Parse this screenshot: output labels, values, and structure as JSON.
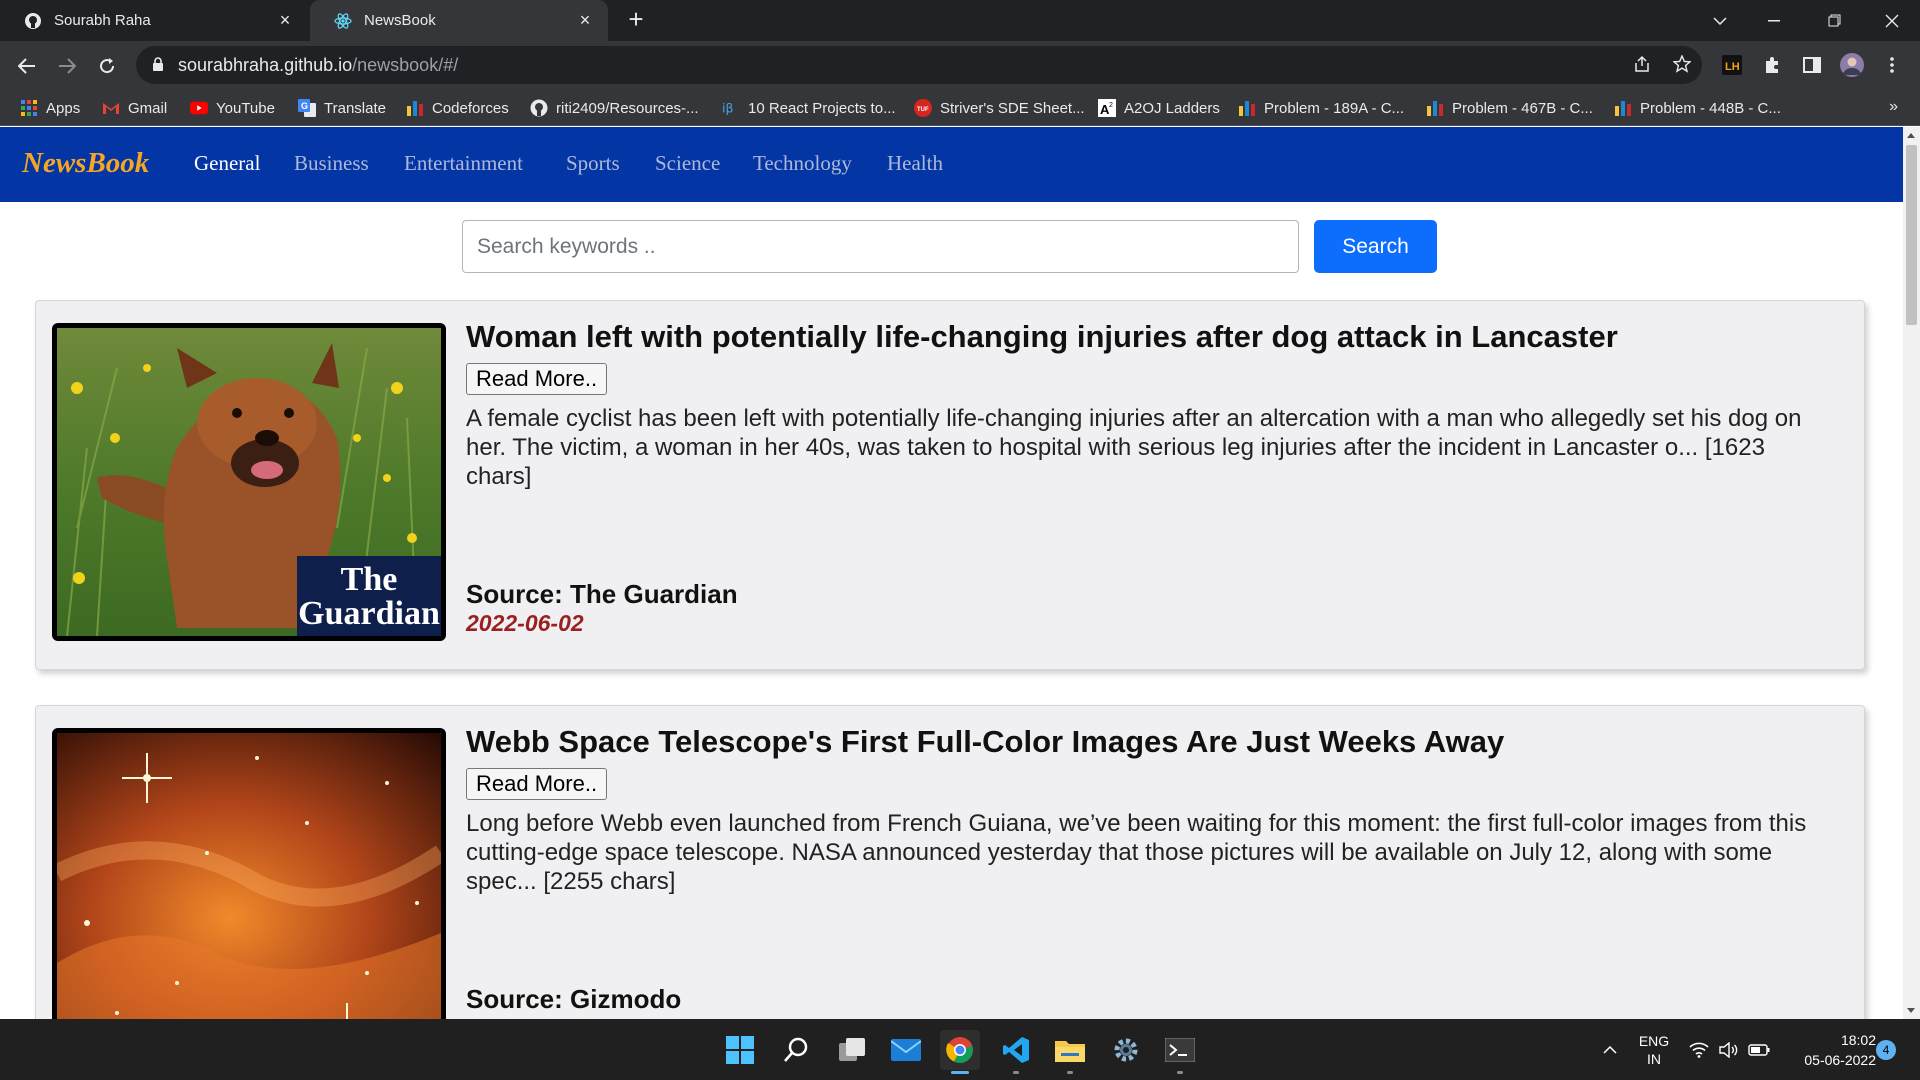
{
  "browser": {
    "tabs": [
      {
        "title": "Sourabh Raha"
      },
      {
        "title": "NewsBook"
      }
    ],
    "url_host": "sourabhraha.github.io",
    "url_path": "/newsbook/#/",
    "bookmarks": [
      {
        "label": "Apps"
      },
      {
        "label": "Gmail"
      },
      {
        "label": "YouTube"
      },
      {
        "label": "Translate"
      },
      {
        "label": "Codeforces"
      },
      {
        "label": "riti2409/Resources-..."
      },
      {
        "label": "10 React Projects to..."
      },
      {
        "label": "Striver's SDE Sheet..."
      },
      {
        "label": "A2OJ Ladders"
      },
      {
        "label": "Problem - 189A - C..."
      },
      {
        "label": "Problem - 467B - C..."
      },
      {
        "label": "Problem - 448B - C..."
      }
    ],
    "bookmarks_more": "»"
  },
  "app": {
    "brand": "NewsBook",
    "nav": [
      {
        "label": "General",
        "active": true
      },
      {
        "label": "Business"
      },
      {
        "label": "Entertainment"
      },
      {
        "label": "Sports"
      },
      {
        "label": "Science"
      },
      {
        "label": "Technology"
      },
      {
        "label": "Health"
      }
    ],
    "search": {
      "placeholder": "Search keywords ..",
      "value": "",
      "button_label": "Search"
    },
    "articles": [
      {
        "title": "Woman left with potentially life-changing injuries after dog attack in Lancaster",
        "read_more": "Read More..",
        "description": "A female cyclist has been left with potentially life-changing injuries after an altercation with a man who allegedly set his dog on her. The victim, a woman in her 40s, was taken to hospital with serious leg injuries after the incident in Lancaster o... [1623 chars]",
        "source": "Source: The Guardian",
        "date": "2022-06-02",
        "image_logo_line1": "The",
        "image_logo_line2": "Guardian"
      },
      {
        "title": "Webb Space Telescope's First Full-Color Images Are Just Weeks Away",
        "read_more": "Read More..",
        "description": "Long before Webb even launched from French Guiana, we’ve been waiting for this moment: the first full-color images from this cutting-edge space telescope. NASA announced yesterday that those pictures will be available on July 12, along with some spec... [2255 chars]",
        "source": "Source: Gizmodo"
      }
    ]
  },
  "taskbar": {
    "lang_line1": "ENG",
    "lang_line2": "IN",
    "time": "18:02",
    "date": "05-06-2022",
    "notifications": "4"
  },
  "colors": {
    "navbar": "#0335a5",
    "brand": "#f6a623",
    "search_button": "#0d6efd",
    "date_text": "#9a1f1f"
  }
}
